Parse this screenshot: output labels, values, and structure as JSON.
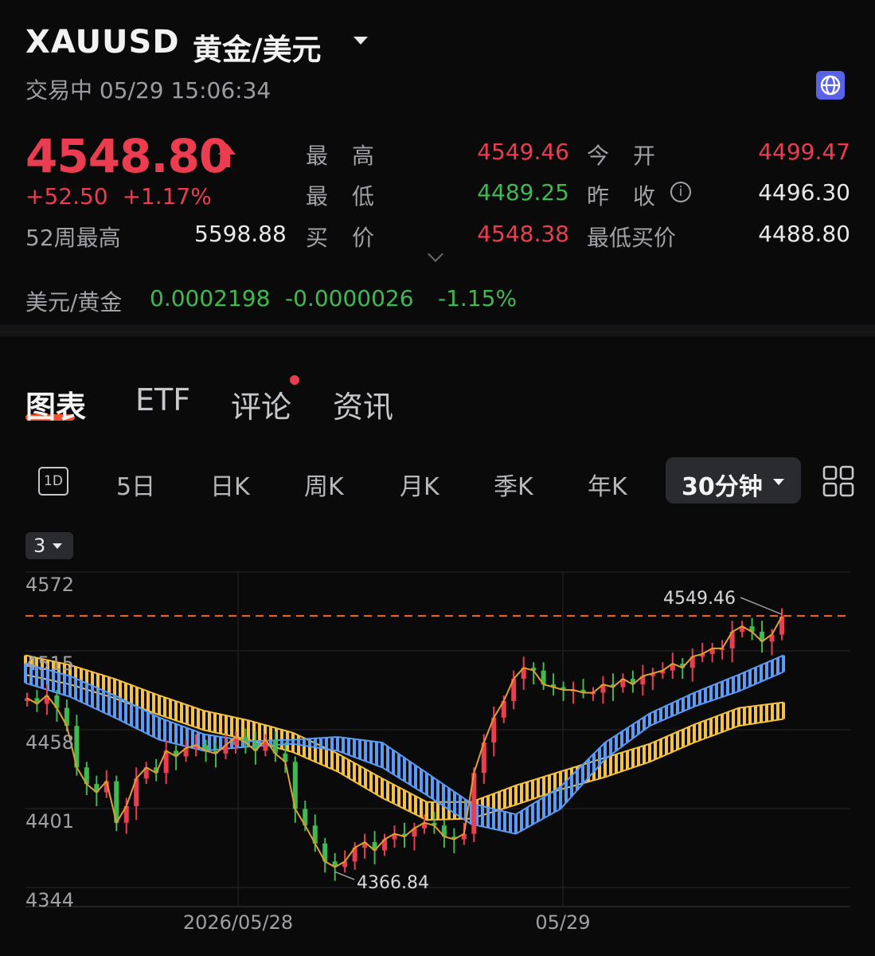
{
  "header": {
    "symbol": "XAUUSD",
    "name": "黄金/美元",
    "status": "交易中 05/29 15:06:34",
    "price": "4548.80",
    "change": "+52.50",
    "change_pct": "+1.17%"
  },
  "stats": {
    "high_label": "最高",
    "high_value": "4549.46",
    "open_label": "今开",
    "open_value": "4499.47",
    "low_label": "最低",
    "low_value": "4489.25",
    "prev_close_label": "昨收",
    "prev_close_value": "4496.30",
    "bid_label": "买价",
    "bid_value": "4548.38",
    "min_bid_label": "最低买价",
    "min_bid_value": "4488.80",
    "w52_high_label": "52周最高",
    "w52_high_value": "5598.88"
  },
  "inverse": {
    "label": "美元/黄金",
    "value": "0.0002198",
    "change": "-0.0000026",
    "change_pct": "-1.15%"
  },
  "tabs": [
    "图表",
    "ETF",
    "评论",
    "资讯"
  ],
  "periods": {
    "icon_1d": "1D",
    "items": [
      "5日",
      "日K",
      "周K",
      "月K",
      "季K",
      "年K"
    ],
    "selected": "30分钟"
  },
  "ma_selector": "3",
  "icons": {
    "dropdown": "chevron-down-icon",
    "globe": "globe-icon",
    "price_up": "arrow-up-icon",
    "info": "info-icon",
    "expand": "chevron-down-icon",
    "layout": "grid-layout-icon"
  },
  "colors": {
    "up": "#ec3d50",
    "down": "#3fb950",
    "accent": "#f2542d",
    "ma_blue": "#5b9bf4",
    "ma_yellow": "#f4c045"
  },
  "chart_data": {
    "type": "candlestick",
    "interval": "30分钟",
    "y_ticks": [
      "4572",
      "4515",
      "4458",
      "4401",
      "4344"
    ],
    "y_tick_values": [
      4572,
      4515,
      4458,
      4401,
      4344
    ],
    "ylim": [
      4344,
      4572
    ],
    "x_labels": [
      "2026/05/28",
      "05/29"
    ],
    "max_label": "4549.46",
    "max_value": 4549.46,
    "min_label": "4366.84",
    "min_value": 4366.84,
    "close_series": [
      4490,
      4486,
      4492,
      4483,
      4470,
      4440,
      4428,
      4422,
      4430,
      4400,
      4412,
      4432,
      4440,
      4436,
      4452,
      4448,
      4454,
      4456,
      4452,
      4450,
      4456,
      4462,
      4458,
      4452,
      4460,
      4450,
      4444,
      4410,
      4398,
      4385,
      4372,
      4368,
      4372,
      4382,
      4386,
      4380,
      4388,
      4392,
      4390,
      4396,
      4400,
      4398,
      4390,
      4388,
      4392,
      4436,
      4458,
      4476,
      4488,
      4504,
      4512,
      4510,
      4500,
      4498,
      4496,
      4496,
      4494,
      4494,
      4500,
      4498,
      4504,
      4500,
      4506,
      4508,
      4510,
      4515,
      4512,
      4520,
      4522,
      4526,
      4526,
      4538,
      4542,
      4538,
      4531,
      4536,
      4549
    ],
    "ma_blue_upper": [
      4515,
      4506,
      4492,
      4476,
      4464,
      4459,
      4460,
      4462,
      4458,
      4436,
      4414,
      4406,
      4426,
      4458,
      4479,
      4494,
      4507,
      4521
    ],
    "ma_blue_lower": [
      4501,
      4491,
      4476,
      4460,
      4452,
      4455,
      4457,
      4452,
      4440,
      4420,
      4399,
      4392,
      4410,
      4446,
      4470,
      4484,
      4495,
      4509
    ],
    "ma_yellow_upper": [
      4521,
      4514,
      4504,
      4492,
      4481,
      4474,
      4465,
      4450,
      4432,
      4415,
      4415,
      4427,
      4437,
      4447,
      4457,
      4471,
      4483,
      4487
    ],
    "ma_yellow_lower": [
      4507,
      4500,
      4490,
      4478,
      4467,
      4460,
      4451,
      4437,
      4418,
      4402,
      4403,
      4413,
      4424,
      4433,
      4444,
      4458,
      4470,
      4475
    ]
  }
}
